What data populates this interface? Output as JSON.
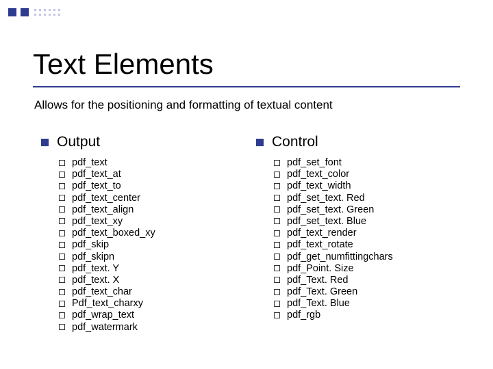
{
  "title": "Text Elements",
  "subtitle": "Allows for the positioning and formatting of textual content",
  "columns": [
    {
      "heading": "Output",
      "items": [
        "pdf_text",
        "pdf_text_at",
        "pdf_text_to",
        "pdf_text_center",
        "pdf_text_align",
        "pdf_text_xy",
        "pdf_text_boxed_xy",
        "pdf_skip",
        "pdf_skipn",
        "pdf_text. Y",
        "pdf_text. X",
        "pdf_text_char",
        "Pdf_text_charxy",
        "pdf_wrap_text",
        "pdf_watermark"
      ]
    },
    {
      "heading": "Control",
      "items": [
        "pdf_set_font",
        "pdf_text_color",
        "pdf_text_width",
        "pdf_set_text. Red",
        "pdf_set_text. Green",
        "pdf_set_text. Blue",
        "pdf_text_render",
        "pdf_text_rotate",
        "pdf_get_numfittingchars",
        "pdf_Point. Size",
        "pdf_Text. Red",
        "pdf_Text. Green",
        "pdf_Text. Blue",
        "pdf_rgb"
      ]
    }
  ]
}
